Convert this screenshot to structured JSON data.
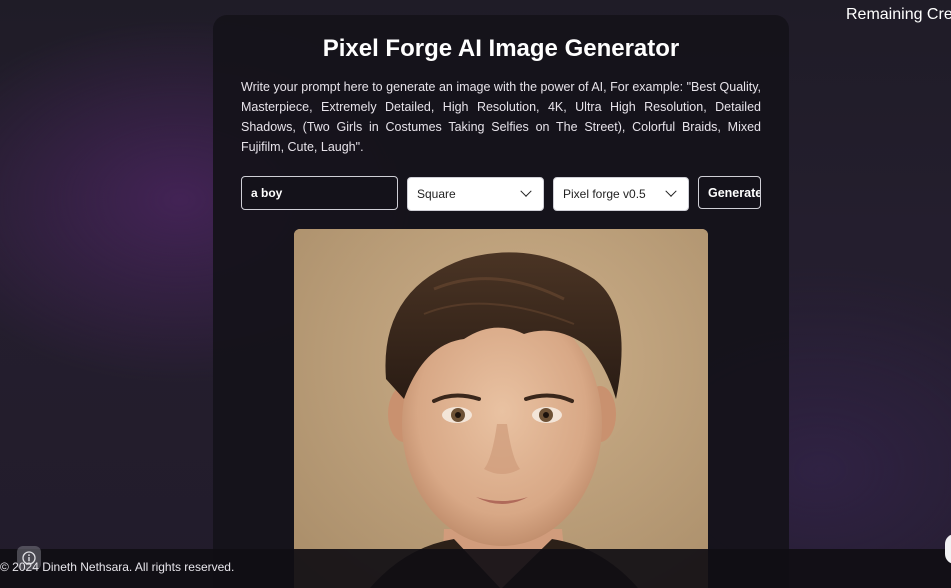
{
  "header": {
    "remaining_credits": "Remaining Cre"
  },
  "card": {
    "title": "Pixel Forge AI Image Generator",
    "description": "Write your prompt here to generate an image with the power of AI, For example: \"Best Quality, Masterpiece, Extremely Detailed, High Resolution, 4K, Ultra High Resolution, Detailed Shadows, (Two Girls in Costumes Taking Selfies on The Street), Colorful Braids, Mixed Fujifilm, Cute, Laugh\"."
  },
  "form": {
    "prompt_value": "a boy",
    "size_selected": "Square",
    "model_selected": "Pixel forge v0.5",
    "generate_label": "Generate"
  },
  "result": {
    "image_alt": "a boy"
  },
  "footer": {
    "copyright": "© 2024 Dineth Nethsara. All rights reserved."
  },
  "icons": {
    "info": "info-icon",
    "dropdown": "chevron-down-icon",
    "edge": "floating-action-icon"
  }
}
